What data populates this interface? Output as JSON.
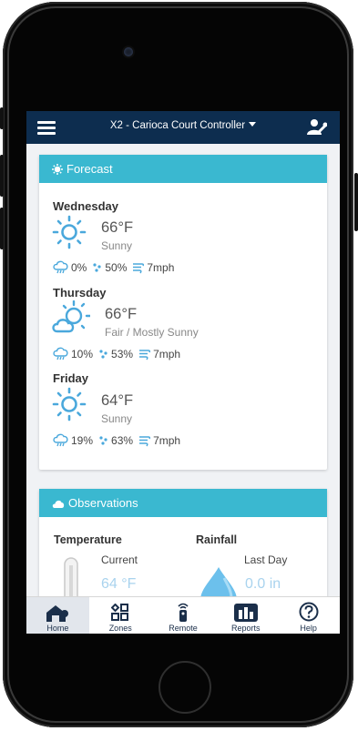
{
  "app": {
    "title": "X2 - Carioca Court Controller"
  },
  "forecast": {
    "header": "Forecast",
    "days": [
      {
        "name": "Wednesday",
        "temp": "66°F",
        "condition": "Sunny",
        "rain": "0%",
        "humidity": "50%",
        "wind": "7mph",
        "icon": "sun-icon"
      },
      {
        "name": "Thursday",
        "temp": "66°F",
        "condition": "Fair / Mostly Sunny",
        "rain": "10%",
        "humidity": "53%",
        "wind": "7mph",
        "icon": "partly-cloudy-icon"
      },
      {
        "name": "Friday",
        "temp": "64°F",
        "condition": "Sunny",
        "rain": "19%",
        "humidity": "63%",
        "wind": "7mph",
        "icon": "sun-icon"
      }
    ]
  },
  "observations": {
    "header": "Observations",
    "temperature": {
      "label": "Temperature",
      "sub": "Current",
      "value": "64 °F"
    },
    "rainfall": {
      "label": "Rainfall",
      "sub": "Last Day",
      "value": "0.0 in"
    }
  },
  "tabs": [
    {
      "label": "Home",
      "icon": "home-icon",
      "active": true
    },
    {
      "label": "Zones",
      "icon": "zones-icon",
      "active": false
    },
    {
      "label": "Remote",
      "icon": "remote-icon",
      "active": false
    },
    {
      "label": "Reports",
      "icon": "reports-icon",
      "active": false
    },
    {
      "label": "Help",
      "icon": "help-icon",
      "active": false
    }
  ],
  "colors": {
    "nav": "#0d2d4f",
    "accent": "#3ab8d0",
    "icon_blue": "#4aa8dc"
  }
}
